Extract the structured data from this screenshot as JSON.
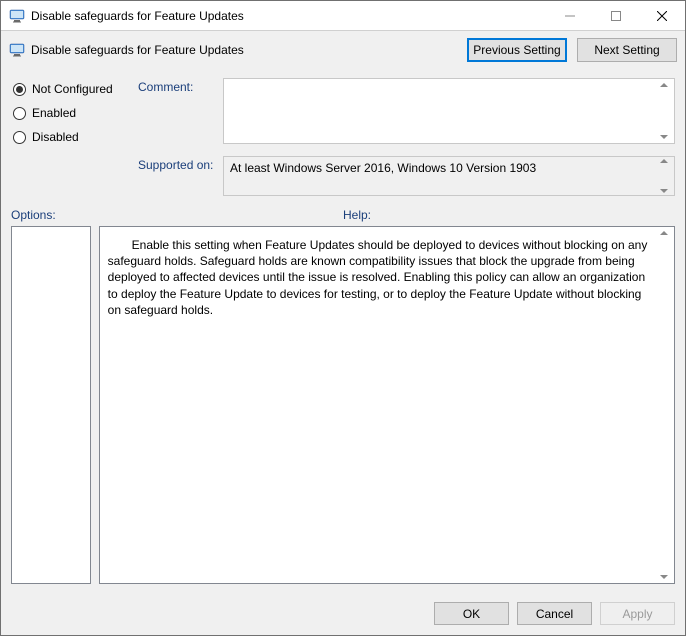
{
  "window": {
    "title": "Disable safeguards for Feature Updates"
  },
  "header": {
    "policy_title": "Disable safeguards for Feature Updates",
    "prev_button": "Previous Setting",
    "next_button": "Next Setting"
  },
  "state": {
    "options": {
      "not_configured": "Not Configured",
      "enabled": "Enabled",
      "disabled": "Disabled"
    },
    "selected": "not_configured"
  },
  "fields": {
    "comment_label": "Comment:",
    "comment_value": "",
    "supported_label": "Supported on:",
    "supported_value": "At least Windows Server 2016, Windows 10 Version 1903"
  },
  "panels": {
    "options_label": "Options:",
    "help_label": "Help:",
    "help_text": "Enable this setting when Feature Updates should be deployed to devices without blocking on any safeguard holds. Safeguard holds are known compatibility issues that block the upgrade from being deployed to affected devices until the issue is resolved. Enabling this policy can allow an organization to deploy the Feature Update to devices for testing, or to deploy the Feature Update without blocking on safeguard holds."
  },
  "footer": {
    "ok": "OK",
    "cancel": "Cancel",
    "apply": "Apply"
  }
}
